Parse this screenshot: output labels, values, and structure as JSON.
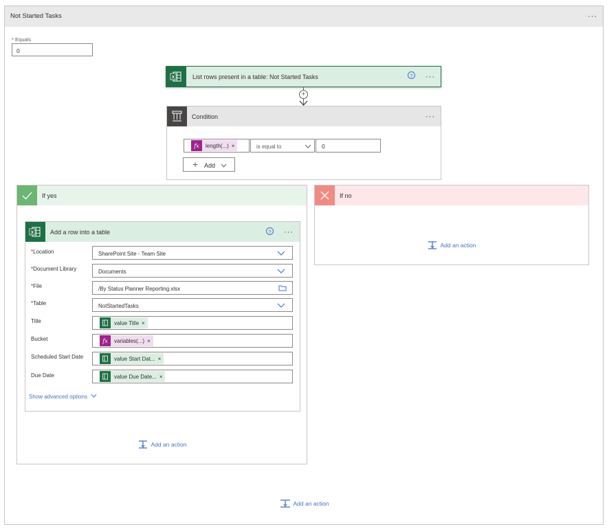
{
  "scope": {
    "title": "Not Started Tasks",
    "equals_label": "Equals",
    "equals_value": "0"
  },
  "list_rows": {
    "title": "List rows present in a table: Not Started Tasks",
    "help": "?"
  },
  "condition": {
    "title": "Condition",
    "left_token": "length(...)",
    "operator": "is equal to",
    "right_value": "0",
    "add_label": "Add"
  },
  "if_yes": {
    "title": "If yes",
    "add_row": {
      "title": "Add a row into a table",
      "help": "?",
      "fields": [
        {
          "label": "Location",
          "required": true,
          "value": "SharePoint Site - Team Site"
        },
        {
          "label": "Document Library",
          "required": true,
          "value": "Documents"
        },
        {
          "label": "File",
          "required": true,
          "value": "/By Status Planner Reporting.xlsx"
        },
        {
          "label": "Table",
          "required": true,
          "value": "NotStartedTasks"
        },
        {
          "label": "Title",
          "required": false,
          "token": "value Title"
        },
        {
          "label": "Bucket",
          "required": false,
          "token": "variables(...)"
        },
        {
          "label": "Scheduled Start Date",
          "required": false,
          "token": "value Start Dat..."
        },
        {
          "label": "Due Date",
          "required": false,
          "token": "value Due Date..."
        }
      ],
      "advanced": "Show advanced options"
    },
    "add_action": "Add an action"
  },
  "if_no": {
    "title": "If no",
    "add_action": "Add an action"
  },
  "bottom_add_action": "Add an action",
  "symbols": {
    "required": "*",
    "remove": "×",
    "dots": "···",
    "plus": "+",
    "fx": "fx"
  },
  "colors": {
    "excel_green": "#1e7145",
    "condition_gray": "#484644",
    "yes_green": "#6bb672",
    "no_red": "#f08b82",
    "fx_purple": "#a0238c",
    "link_blue": "#4373c5"
  }
}
